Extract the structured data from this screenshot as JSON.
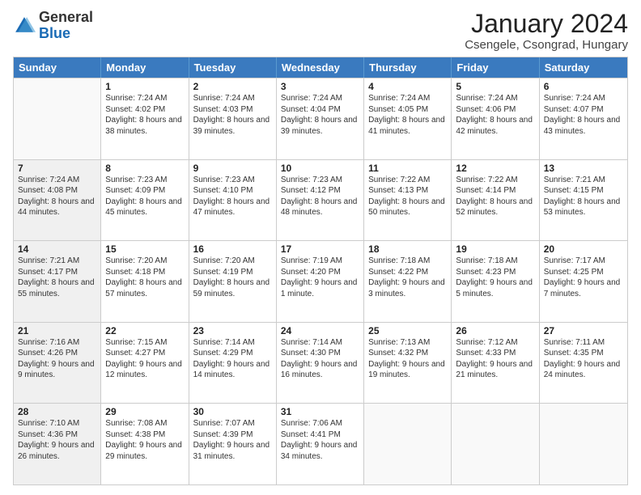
{
  "logo": {
    "general": "General",
    "blue": "Blue"
  },
  "header": {
    "month_title": "January 2024",
    "location": "Csengele, Csongrad, Hungary"
  },
  "days_of_week": [
    "Sunday",
    "Monday",
    "Tuesday",
    "Wednesday",
    "Thursday",
    "Friday",
    "Saturday"
  ],
  "weeks": [
    [
      {
        "num": "",
        "sunrise": "",
        "sunset": "",
        "daylight": "",
        "empty": true
      },
      {
        "num": "1",
        "sunrise": "Sunrise: 7:24 AM",
        "sunset": "Sunset: 4:02 PM",
        "daylight": "Daylight: 8 hours and 38 minutes."
      },
      {
        "num": "2",
        "sunrise": "Sunrise: 7:24 AM",
        "sunset": "Sunset: 4:03 PM",
        "daylight": "Daylight: 8 hours and 39 minutes."
      },
      {
        "num": "3",
        "sunrise": "Sunrise: 7:24 AM",
        "sunset": "Sunset: 4:04 PM",
        "daylight": "Daylight: 8 hours and 39 minutes."
      },
      {
        "num": "4",
        "sunrise": "Sunrise: 7:24 AM",
        "sunset": "Sunset: 4:05 PM",
        "daylight": "Daylight: 8 hours and 41 minutes."
      },
      {
        "num": "5",
        "sunrise": "Sunrise: 7:24 AM",
        "sunset": "Sunset: 4:06 PM",
        "daylight": "Daylight: 8 hours and 42 minutes."
      },
      {
        "num": "6",
        "sunrise": "Sunrise: 7:24 AM",
        "sunset": "Sunset: 4:07 PM",
        "daylight": "Daylight: 8 hours and 43 minutes."
      }
    ],
    [
      {
        "num": "7",
        "sunrise": "Sunrise: 7:24 AM",
        "sunset": "Sunset: 4:08 PM",
        "daylight": "Daylight: 8 hours and 44 minutes.",
        "shaded": true
      },
      {
        "num": "8",
        "sunrise": "Sunrise: 7:23 AM",
        "sunset": "Sunset: 4:09 PM",
        "daylight": "Daylight: 8 hours and 45 minutes."
      },
      {
        "num": "9",
        "sunrise": "Sunrise: 7:23 AM",
        "sunset": "Sunset: 4:10 PM",
        "daylight": "Daylight: 8 hours and 47 minutes."
      },
      {
        "num": "10",
        "sunrise": "Sunrise: 7:23 AM",
        "sunset": "Sunset: 4:12 PM",
        "daylight": "Daylight: 8 hours and 48 minutes."
      },
      {
        "num": "11",
        "sunrise": "Sunrise: 7:22 AM",
        "sunset": "Sunset: 4:13 PM",
        "daylight": "Daylight: 8 hours and 50 minutes."
      },
      {
        "num": "12",
        "sunrise": "Sunrise: 7:22 AM",
        "sunset": "Sunset: 4:14 PM",
        "daylight": "Daylight: 8 hours and 52 minutes."
      },
      {
        "num": "13",
        "sunrise": "Sunrise: 7:21 AM",
        "sunset": "Sunset: 4:15 PM",
        "daylight": "Daylight: 8 hours and 53 minutes."
      }
    ],
    [
      {
        "num": "14",
        "sunrise": "Sunrise: 7:21 AM",
        "sunset": "Sunset: 4:17 PM",
        "daylight": "Daylight: 8 hours and 55 minutes.",
        "shaded": true
      },
      {
        "num": "15",
        "sunrise": "Sunrise: 7:20 AM",
        "sunset": "Sunset: 4:18 PM",
        "daylight": "Daylight: 8 hours and 57 minutes."
      },
      {
        "num": "16",
        "sunrise": "Sunrise: 7:20 AM",
        "sunset": "Sunset: 4:19 PM",
        "daylight": "Daylight: 8 hours and 59 minutes."
      },
      {
        "num": "17",
        "sunrise": "Sunrise: 7:19 AM",
        "sunset": "Sunset: 4:20 PM",
        "daylight": "Daylight: 9 hours and 1 minute."
      },
      {
        "num": "18",
        "sunrise": "Sunrise: 7:18 AM",
        "sunset": "Sunset: 4:22 PM",
        "daylight": "Daylight: 9 hours and 3 minutes."
      },
      {
        "num": "19",
        "sunrise": "Sunrise: 7:18 AM",
        "sunset": "Sunset: 4:23 PM",
        "daylight": "Daylight: 9 hours and 5 minutes."
      },
      {
        "num": "20",
        "sunrise": "Sunrise: 7:17 AM",
        "sunset": "Sunset: 4:25 PM",
        "daylight": "Daylight: 9 hours and 7 minutes."
      }
    ],
    [
      {
        "num": "21",
        "sunrise": "Sunrise: 7:16 AM",
        "sunset": "Sunset: 4:26 PM",
        "daylight": "Daylight: 9 hours and 9 minutes.",
        "shaded": true
      },
      {
        "num": "22",
        "sunrise": "Sunrise: 7:15 AM",
        "sunset": "Sunset: 4:27 PM",
        "daylight": "Daylight: 9 hours and 12 minutes."
      },
      {
        "num": "23",
        "sunrise": "Sunrise: 7:14 AM",
        "sunset": "Sunset: 4:29 PM",
        "daylight": "Daylight: 9 hours and 14 minutes."
      },
      {
        "num": "24",
        "sunrise": "Sunrise: 7:14 AM",
        "sunset": "Sunset: 4:30 PM",
        "daylight": "Daylight: 9 hours and 16 minutes."
      },
      {
        "num": "25",
        "sunrise": "Sunrise: 7:13 AM",
        "sunset": "Sunset: 4:32 PM",
        "daylight": "Daylight: 9 hours and 19 minutes."
      },
      {
        "num": "26",
        "sunrise": "Sunrise: 7:12 AM",
        "sunset": "Sunset: 4:33 PM",
        "daylight": "Daylight: 9 hours and 21 minutes."
      },
      {
        "num": "27",
        "sunrise": "Sunrise: 7:11 AM",
        "sunset": "Sunset: 4:35 PM",
        "daylight": "Daylight: 9 hours and 24 minutes."
      }
    ],
    [
      {
        "num": "28",
        "sunrise": "Sunrise: 7:10 AM",
        "sunset": "Sunset: 4:36 PM",
        "daylight": "Daylight: 9 hours and 26 minutes.",
        "shaded": true
      },
      {
        "num": "29",
        "sunrise": "Sunrise: 7:08 AM",
        "sunset": "Sunset: 4:38 PM",
        "daylight": "Daylight: 9 hours and 29 minutes."
      },
      {
        "num": "30",
        "sunrise": "Sunrise: 7:07 AM",
        "sunset": "Sunset: 4:39 PM",
        "daylight": "Daylight: 9 hours and 31 minutes."
      },
      {
        "num": "31",
        "sunrise": "Sunrise: 7:06 AM",
        "sunset": "Sunset: 4:41 PM",
        "daylight": "Daylight: 9 hours and 34 minutes."
      },
      {
        "num": "",
        "sunrise": "",
        "sunset": "",
        "daylight": "",
        "empty": true
      },
      {
        "num": "",
        "sunrise": "",
        "sunset": "",
        "daylight": "",
        "empty": true
      },
      {
        "num": "",
        "sunrise": "",
        "sunset": "",
        "daylight": "",
        "empty": true
      }
    ]
  ]
}
